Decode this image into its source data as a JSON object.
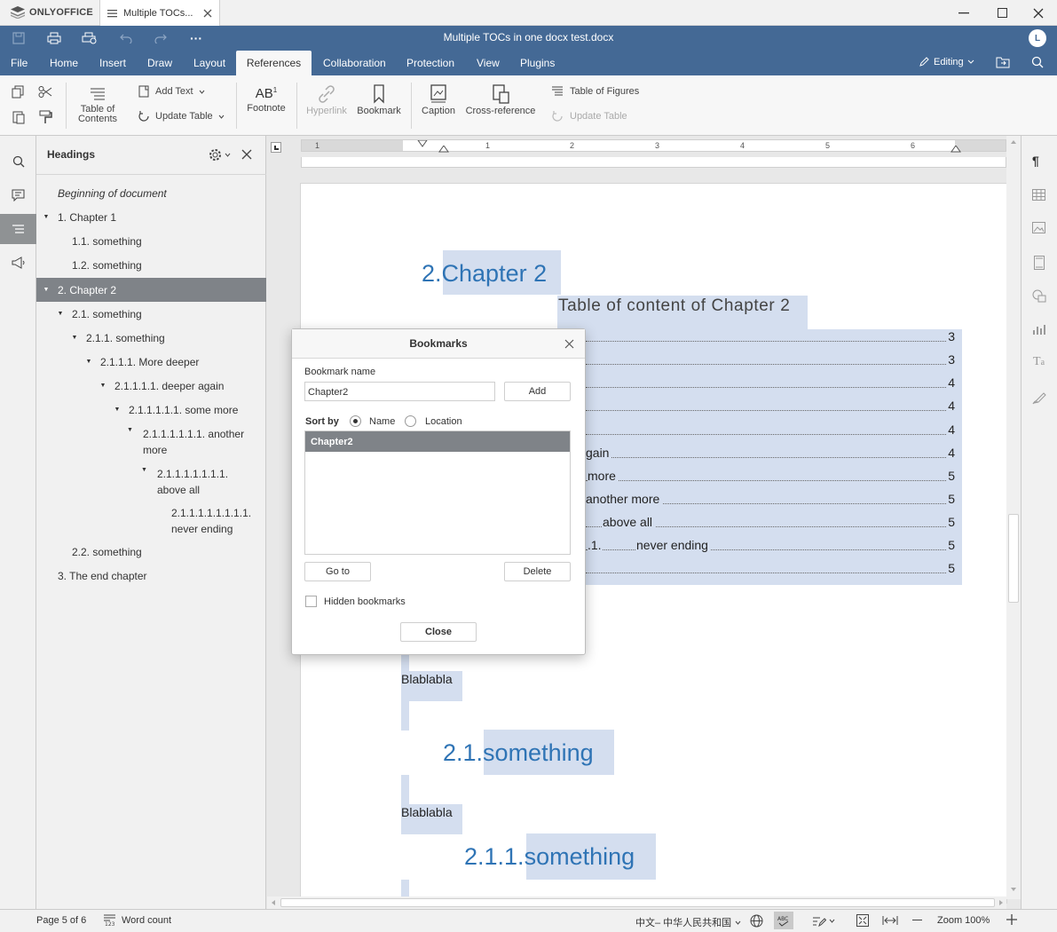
{
  "app": {
    "name": "ONLYOFFICE",
    "tab_name": "Multiple TOCs...",
    "doc_title": "Multiple TOCs in one docx test.docx",
    "user_initial": "L",
    "mode": "Editing"
  },
  "menu": {
    "tabs": [
      "File",
      "Home",
      "Insert",
      "Draw",
      "Layout",
      "References",
      "Collaboration",
      "Protection",
      "View",
      "Plugins"
    ],
    "active": "References"
  },
  "toolbar": {
    "toc_label": "Table of Contents",
    "add_text": "Add Text",
    "update_table": "Update Table",
    "footnote": "Footnote",
    "hyperlink": "Hyperlink",
    "bookmark": "Bookmark",
    "caption": "Caption",
    "cross_reference": "Cross-reference",
    "table_of_figures": "Table of Figures",
    "update_table2": "Update Table"
  },
  "nav": {
    "title": "Headings",
    "items": [
      {
        "label": "Beginning of document"
      },
      {
        "label": "1. Chapter 1"
      },
      {
        "label": "1.1. something"
      },
      {
        "label": "1.2. something"
      },
      {
        "label": "2. Chapter 2"
      },
      {
        "label": "2.1. something"
      },
      {
        "label": "2.1.1. something"
      },
      {
        "label": "2.1.1.1. More deeper"
      },
      {
        "label": "2.1.1.1.1. deeper again"
      },
      {
        "label": "2.1.1.1.1.1. some more"
      },
      {
        "label": "2.1.1.1.1.1.1. another"
      },
      {
        "label": "more"
      },
      {
        "label": "2.1.1.1.1.1.1.1."
      },
      {
        "label": "above all"
      },
      {
        "label": "2.1.1.1.1.1.1.1.1."
      },
      {
        "label": "never ending"
      },
      {
        "label": "2.2. something"
      },
      {
        "label": "3. The end chapter"
      }
    ]
  },
  "document": {
    "heading": "2.Chapter 2",
    "heading_num": "2.",
    "heading_text": "Chapter 2",
    "toc_title": "Table of content of Chapter 2",
    "toc_pages": [
      "3",
      "3",
      "4",
      "4",
      "4",
      "4",
      "5",
      "5",
      "5",
      "5",
      "5"
    ],
    "toc_fragments": [
      "gain",
      "more",
      "another more",
      "above all",
      ".1.",
      "never ending"
    ],
    "body1": "Blablabla",
    "h2_num": "2.1.",
    "h2_text": "something",
    "body2": "Blablabla",
    "h3_num": "2.1.1.",
    "h3_text": "something"
  },
  "dialog": {
    "title": "Bookmarks",
    "name_label": "Bookmark name",
    "name_value": "Chapter2",
    "add": "Add",
    "sort_by": "Sort by",
    "sort_name": "Name",
    "sort_location": "Location",
    "list": [
      "Chapter2"
    ],
    "goto": "Go to",
    "delete": "Delete",
    "hidden": "Hidden bookmarks",
    "close": "Close"
  },
  "status": {
    "page": "Page 5 of 6",
    "word_count": "Word count",
    "language": "中文– 中华人民共和国",
    "zoom": "Zoom 100%"
  },
  "ruler": {
    "numbers": [
      "1",
      "1",
      "2",
      "3",
      "4",
      "5",
      "6"
    ]
  }
}
